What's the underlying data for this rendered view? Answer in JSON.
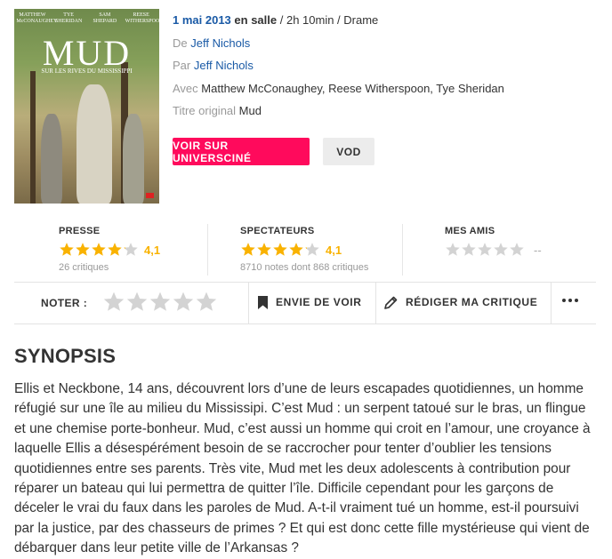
{
  "poster": {
    "actors": [
      "MATTHEW McCONAUGHEY",
      "TYE SHERIDAN",
      "SAM SHEPARD",
      "REESE WITHERSPOON"
    ],
    "title": "MUD",
    "subtitle": "SUR LES RIVES DU MISSISSIPPI"
  },
  "info": {
    "date": "1 mai 2013",
    "release_suffix": "en salle",
    "duration_genre": "/ 2h 10min / Drame",
    "director_label": "De",
    "director": "Jeff Nichols",
    "writer_label": "Par",
    "writer": "Jeff Nichols",
    "cast_label": "Avec",
    "cast": "Matthew McConaughey, Reese Witherspoon, Tye Sheridan",
    "original_title_label": "Titre original",
    "original_title": "Mud"
  },
  "buttons": {
    "primary": "VOIR SUR UNIVERSCINÉ",
    "vod": "VOD"
  },
  "ratings": {
    "press": {
      "label": "PRESSE",
      "score_text": "4,1",
      "score": 4.1,
      "count": "26 critiques"
    },
    "spectators": {
      "label": "SPECTATEURS",
      "score_text": "4,1",
      "score": 4.1,
      "count": "8710 notes dont 868 critiques"
    },
    "friends": {
      "label": "MES AMIS",
      "score_text": "--"
    }
  },
  "actions": {
    "rate_label": "NOTER :",
    "wishlist": "ENVIE DE VOIR",
    "review": "RÉDIGER MA CRITIQUE"
  },
  "synopsis": {
    "title": "SYNOPSIS",
    "text": "Ellis et Neckbone, 14 ans, découvrent lors d’une de leurs escapades quotidiennes, un homme réfugié sur une île au milieu du Mississipi. C’est Mud : un serpent tatoué sur le bras, un flingue et une chemise porte-bonheur. Mud, c’est aussi un homme qui croit en l’amour, une croyance à laquelle Ellis a désespérément besoin de se raccrocher pour tenter d’oublier les tensions quotidiennes entre ses parents. Très vite, Mud met les deux adolescents à contribution pour réparer un bateau qui lui permettra de quitter l’île. Difficile cependant pour les garçons de déceler le vrai du faux dans les paroles de Mud. A-t-il vraiment tué un homme, est-il poursuivi par la justice, par des chasseurs de primes ? Et qui est donc cette fille mystérieuse qui vient de débarquer dans leur petite ville de l’Arkansas ?"
  },
  "colors": {
    "accent": "#ff0a5c",
    "star": "#f9b200",
    "star_empty": "#d3d3d3",
    "link": "#1a5aa6"
  }
}
